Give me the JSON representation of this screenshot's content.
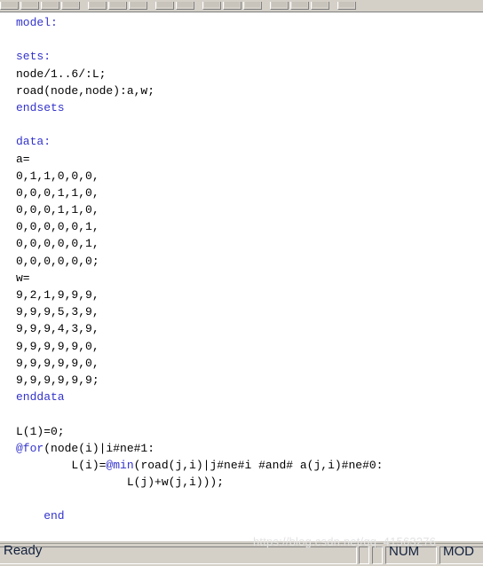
{
  "toolbar": {
    "name": "lingo-toolbar",
    "groups": [
      {
        "buttons": [
          "new-button",
          "open-button",
          "save-button",
          "print-button"
        ]
      },
      {
        "buttons": [
          "cut-button",
          "copy-button",
          "paste-button"
        ]
      },
      {
        "buttons": [
          "undo-button",
          "redo-button"
        ]
      },
      {
        "buttons": [
          "find-button",
          "replace-button",
          "goto-button"
        ]
      },
      {
        "buttons": [
          "solve-button",
          "solution-button",
          "options-button"
        ]
      },
      {
        "buttons": [
          "help-button"
        ]
      }
    ]
  },
  "editor": {
    "name": "lingo-model-editor",
    "language": "LINGO",
    "lines": [
      {
        "indent": 0,
        "segments": [
          {
            "t": "model:",
            "c": "kw"
          }
        ]
      },
      {
        "indent": 0,
        "segments": []
      },
      {
        "indent": 0,
        "segments": [
          {
            "t": "sets:",
            "c": "kw"
          }
        ]
      },
      {
        "indent": 0,
        "segments": [
          {
            "t": "node/1..6/:L;",
            "c": ""
          }
        ]
      },
      {
        "indent": 0,
        "segments": [
          {
            "t": "road(node,node):a,w;",
            "c": ""
          }
        ]
      },
      {
        "indent": 0,
        "segments": [
          {
            "t": "endsets",
            "c": "kw"
          }
        ]
      },
      {
        "indent": 0,
        "segments": []
      },
      {
        "indent": 0,
        "segments": [
          {
            "t": "data:",
            "c": "kw"
          }
        ]
      },
      {
        "indent": 0,
        "segments": [
          {
            "t": "a=",
            "c": ""
          }
        ]
      },
      {
        "indent": 0,
        "segments": [
          {
            "t": "0,1,1,0,0,0,",
            "c": ""
          }
        ]
      },
      {
        "indent": 0,
        "segments": [
          {
            "t": "0,0,0,1,1,0,",
            "c": ""
          }
        ]
      },
      {
        "indent": 0,
        "segments": [
          {
            "t": "0,0,0,1,1,0,",
            "c": ""
          }
        ]
      },
      {
        "indent": 0,
        "segments": [
          {
            "t": "0,0,0,0,0,1,",
            "c": ""
          }
        ]
      },
      {
        "indent": 0,
        "segments": [
          {
            "t": "0,0,0,0,0,1,",
            "c": ""
          }
        ]
      },
      {
        "indent": 0,
        "segments": [
          {
            "t": "0,0,0,0,0,0;",
            "c": ""
          }
        ]
      },
      {
        "indent": 0,
        "segments": [
          {
            "t": "w=",
            "c": ""
          }
        ]
      },
      {
        "indent": 0,
        "segments": [
          {
            "t": "9,2,1,9,9,9,",
            "c": ""
          }
        ]
      },
      {
        "indent": 0,
        "segments": [
          {
            "t": "9,9,9,5,3,9,",
            "c": ""
          }
        ]
      },
      {
        "indent": 0,
        "segments": [
          {
            "t": "9,9,9,4,3,9,",
            "c": ""
          }
        ]
      },
      {
        "indent": 0,
        "segments": [
          {
            "t": "9,9,9,9,9,0,",
            "c": ""
          }
        ]
      },
      {
        "indent": 0,
        "segments": [
          {
            "t": "9,9,9,9,9,0,",
            "c": ""
          }
        ]
      },
      {
        "indent": 0,
        "segments": [
          {
            "t": "9,9,9,9,9,9;",
            "c": ""
          }
        ]
      },
      {
        "indent": 0,
        "segments": [
          {
            "t": "enddata",
            "c": "kw"
          }
        ]
      },
      {
        "indent": 0,
        "segments": []
      },
      {
        "indent": 0,
        "segments": [
          {
            "t": "L(1)=0;",
            "c": ""
          }
        ]
      },
      {
        "indent": 0,
        "segments": [
          {
            "t": "@for",
            "c": "fn"
          },
          {
            "t": "(node(i)|i#ne#1:",
            "c": ""
          }
        ]
      },
      {
        "indent": 0,
        "segments": [
          {
            "t": "        L(i)=",
            "c": ""
          },
          {
            "t": "@min",
            "c": "fn"
          },
          {
            "t": "(road(j,i)|j#ne#i #and# a(j,i)#ne#0:",
            "c": ""
          }
        ]
      },
      {
        "indent": 0,
        "segments": [
          {
            "t": "                L(j)+w(j,i)));",
            "c": ""
          }
        ]
      },
      {
        "indent": 0,
        "segments": []
      },
      {
        "indent": 0,
        "segments": [
          {
            "t": "    end",
            "c": "kw"
          }
        ]
      }
    ],
    "colors": {
      "keyword": "#3333cc",
      "text": "#000000",
      "background": "#ffffff"
    }
  },
  "watermark": {
    "text": "https://blog.csdn.net/qq_41563276"
  },
  "statusbar": {
    "ready_label": "Ready",
    "num_label": "NUM",
    "mod_label": "MOD"
  }
}
